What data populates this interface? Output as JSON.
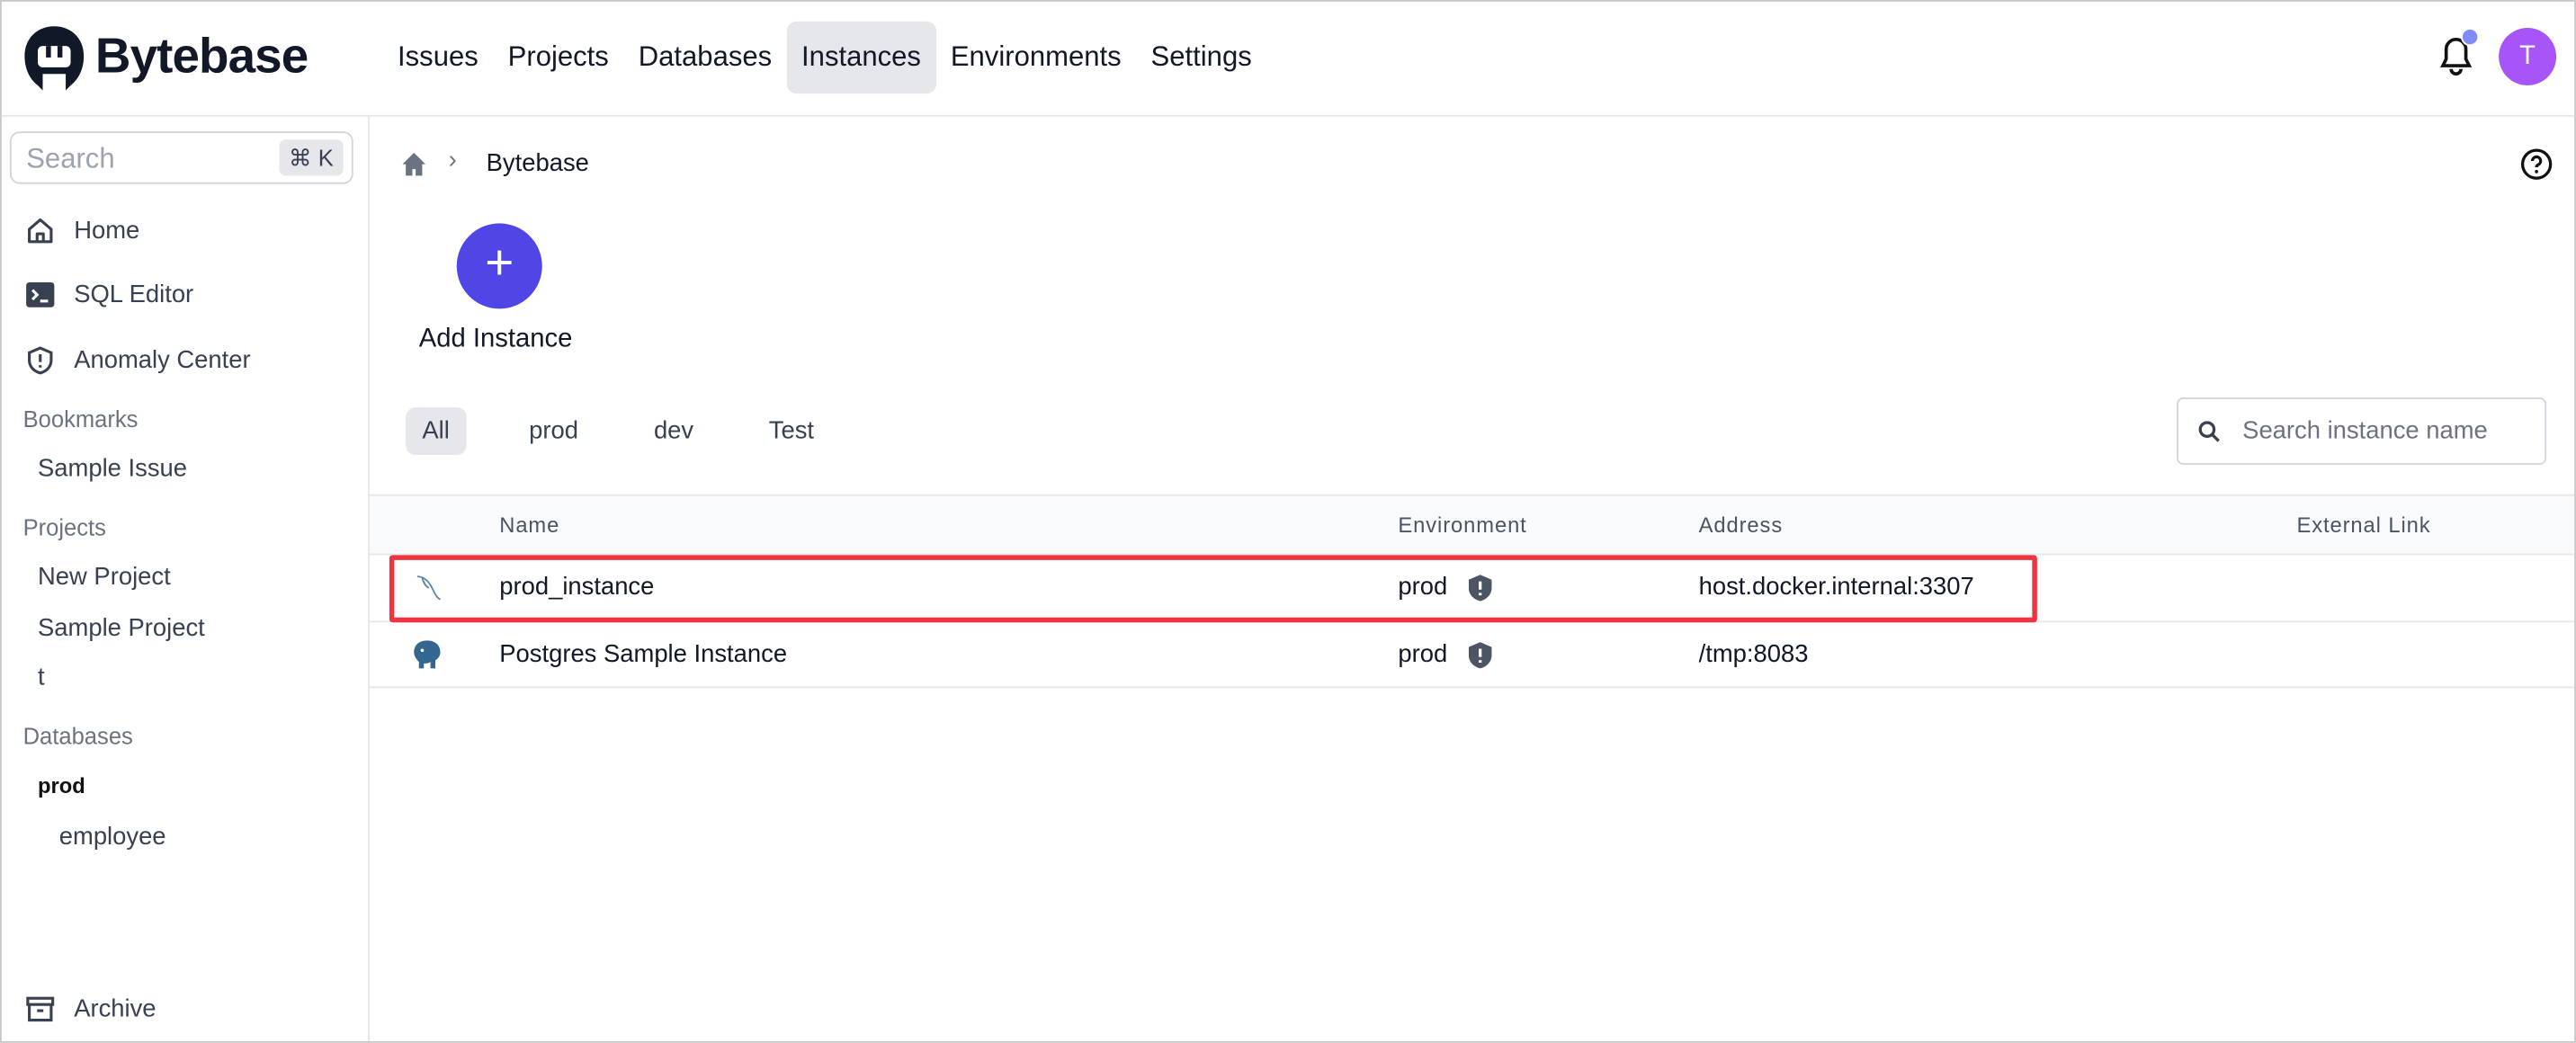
{
  "header": {
    "brand": "Bytebase",
    "nav": [
      "Issues",
      "Projects",
      "Databases",
      "Instances",
      "Environments",
      "Settings"
    ],
    "active_nav": "Instances",
    "avatar_initial": "T",
    "accent": "#4f46e5"
  },
  "sidebar": {
    "search_placeholder": "Search",
    "shortcut": "⌘ K",
    "items": [
      {
        "label": "Home",
        "icon": "home-icon"
      },
      {
        "label": "SQL Editor",
        "icon": "terminal-icon"
      },
      {
        "label": "Anomaly Center",
        "icon": "shield-alert-icon"
      }
    ],
    "bookmarks_title": "Bookmarks",
    "bookmarks": [
      "Sample Issue"
    ],
    "projects_title": "Projects",
    "projects": [
      "New Project",
      "Sample Project",
      "t"
    ],
    "databases_title": "Databases",
    "db_env": "prod",
    "databases": [
      "employee"
    ],
    "archive": "Archive"
  },
  "main": {
    "breadcrumb": "Bytebase",
    "add_label": "Add Instance",
    "tabs": [
      "All",
      "prod",
      "dev",
      "Test"
    ],
    "active_tab": "All",
    "search_placeholder": "Search instance name",
    "columns": [
      "Name",
      "Environment",
      "Address",
      "External Link"
    ],
    "rows": [
      {
        "icon": "mysql-icon",
        "name": "prod_instance",
        "env": "prod",
        "address": "host.docker.internal:3307",
        "highlighted": true
      },
      {
        "icon": "postgres-icon",
        "name": "Postgres Sample Instance",
        "env": "prod",
        "address": "/tmp:8083",
        "highlighted": false
      }
    ],
    "highlight_color": "#ef3340"
  }
}
